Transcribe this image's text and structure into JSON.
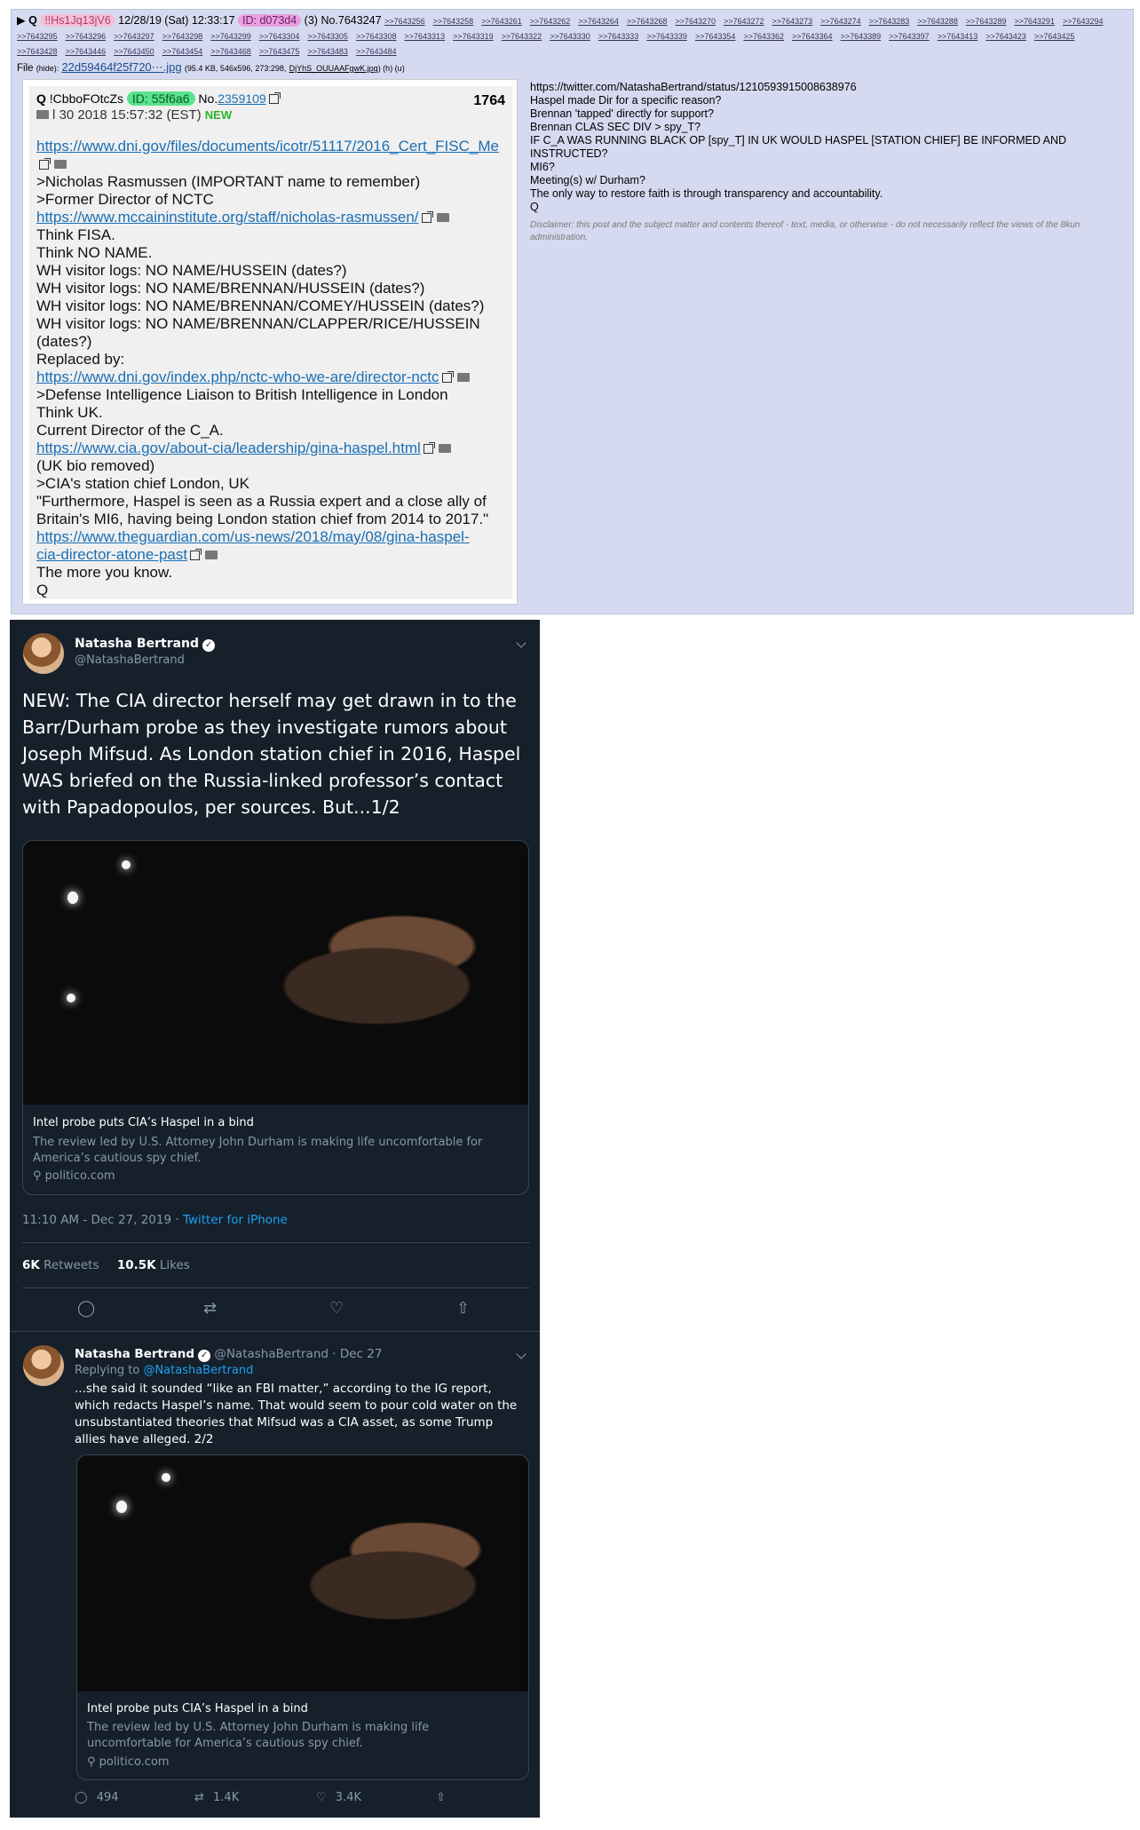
{
  "post": {
    "marker": "▶",
    "q": "Q",
    "tripcode": "!!Hs1Jq13jV6",
    "datetime": "12/28/19 (Sat) 12:33:17",
    "id_label": "ID: d073d4",
    "count": "(3)",
    "number": "No.7643247",
    "reply_links": [
      ">>7643256",
      ">>7643258",
      ">>7643261",
      ">>7643262",
      ">>7643264",
      ">>7643268",
      ">>7643270",
      ">>7643272",
      ">>7643273",
      ">>7643274",
      ">>7643283",
      ">>7643288",
      ">>7643289",
      ">>7643291",
      ">>7643294",
      ">>7643295",
      ">>7643296",
      ">>7643297",
      ">>7643298",
      ">>7643299",
      ">>7643304",
      ">>7643305",
      ">>7643308",
      ">>7643313",
      ">>7643319",
      ">>7643322",
      ">>7643330",
      ">>7643333",
      ">>7643339",
      ">>7643354",
      ">>7643362",
      ">>7643364",
      ">>7643389",
      ">>7643397",
      ">>7643413",
      ">>7643423",
      ">>7643425",
      ">>7643428",
      ">>7643446",
      ">>7643450",
      ">>7643454",
      ">>7643468",
      ">>7643475",
      ">>7643483",
      ">>7643484"
    ],
    "file_label": "File",
    "file_hide": "(hide):",
    "file_name": "22d59464f25f720⋯.jpg",
    "file_meta": "(95.4 KB, 546x596, 273:298,",
    "file_orig": "DjYhS_OUUAAFgwK.jpg",
    "file_tail": ") (h) (u)",
    "right_lines": [
      "https://twitter.com/NatashaBertrand/status/1210593915008638976",
      "Haspel made Dir for a specific reason?",
      "Brennan 'tapped' directly for support?",
      "Brennan CLAS SEC DIV > spy_T?",
      "IF C_A WAS RUNNING BLACK OP [spy_T] IN UK WOULD HASPEL [STATION CHIEF] BE INFORMED AND INSTRUCTED?",
      "MI6?",
      "Meeting(s) w/ Durham?",
      "The only way to restore faith is through transparency and accountability.",
      "Q"
    ],
    "disclaimer": "Disclaimer: this post and the subject matter and contents thereof - text, media, or otherwise - do not necessarily reflect the views of the 8kun administration."
  },
  "old_post": {
    "q": "Q",
    "trip": "!CbboFOtcZs",
    "id_label": "ID: 55f6a6",
    "number_prefix": "No.",
    "number": "2359109",
    "count": "1764",
    "date": "l 30 2018 15:57:32 (EST)",
    "new_tag": "NEW",
    "lines": [
      {
        "t": "https://www.dni.gov/files/documents/icotr/51117/2016_Cert_FISC_Me",
        "link": true
      },
      {
        "t": "",
        "icons": true
      },
      {
        "t": ">Nicholas Rasmussen (IMPORTANT name to remember)"
      },
      {
        "t": ">Former Director of NCTC"
      },
      {
        "t": "https://www.mccaininstitute.org/staff/nicholas-rasmussen/",
        "link": true,
        "icons": true
      },
      {
        "t": "Think FISA."
      },
      {
        "t": "Think NO NAME."
      },
      {
        "t": "WH visitor logs: NO NAME/HUSSEIN (dates?)"
      },
      {
        "t": "WH visitor logs: NO NAME/BRENNAN/HUSSEIN (dates?)"
      },
      {
        "t": "WH visitor logs: NO NAME/BRENNAN/COMEY/HUSSEIN (dates?)"
      },
      {
        "t": "WH visitor logs: NO NAME/BRENNAN/CLAPPER/RICE/HUSSEIN"
      },
      {
        "t": "(dates?)"
      },
      {
        "t": "Replaced by:"
      },
      {
        "t": "https://www.dni.gov/index.php/nctc-who-we-are/director-nctc",
        "link": true,
        "icons": true
      },
      {
        "t": ">Defense Intelligence Liaison to British Intelligence in London"
      },
      {
        "t": "Think UK."
      },
      {
        "t": "Current Director of the C_A."
      },
      {
        "t": "https://www.cia.gov/about-cia/leadership/gina-haspel.html",
        "link": true,
        "icons": true
      },
      {
        "t": "(UK bio removed)"
      },
      {
        "t": ">CIA's station chief London, UK"
      },
      {
        "t": "\"Furthermore, Haspel is seen as a Russia expert and a close ally of"
      },
      {
        "t": "Britain's MI6, having being London station chief from 2014 to 2017.\""
      },
      {
        "t": "https://www.theguardian.com/us-news/2018/may/08/gina-haspel-",
        "link": true
      },
      {
        "t": "cia-director-atone-past",
        "link": true,
        "icons": true
      },
      {
        "t": "The more you know."
      },
      {
        "t": "Q"
      }
    ]
  },
  "tweet1": {
    "name": "Natasha Bertrand",
    "handle": "@NatashaBertrand",
    "text": "NEW: The CIA director herself may get drawn in to the Barr/Durham probe as they investigate rumors about Joseph Mifsud. As London station chief in 2016, Haspel WAS briefed on the Russia-linked professor’s contact with Papadopoulos, per sources. But...1/2",
    "card_title": "Intel probe puts CIA’s Haspel in a bind",
    "card_desc": "The review led by U.S. Attorney John Durham is making life uncomfortable for America’s cautious spy chief.",
    "card_src": "politico.com",
    "time": "11:10 AM - Dec 27, 2019 · ",
    "app": "Twitter for iPhone",
    "retweets": "6K",
    "retweets_label": " Retweets",
    "likes": "10.5K",
    "likes_label": " Likes"
  },
  "tweet2": {
    "name": "Natasha Bertrand",
    "handle": "@NatashaBertrand · Dec 27",
    "replying": "Replying to ",
    "replying_at": "@NatashaBertrand",
    "text": "...she said it sounded “like an FBI matter,” according to the IG report, which redacts Haspel’s name. That would seem to pour cold water on the unsubstantiated theories that Mifsud was a CIA asset, as some Trump allies have alleged. 2/2",
    "card_title": "Intel probe puts CIA’s Haspel in a bind",
    "card_desc": "The review led by U.S. Attorney John Durham is making life uncomfortable for America’s cautious spy chief.",
    "card_src": "politico.com",
    "replies": "494",
    "retweets": "1.4K",
    "likes": "3.4K"
  },
  "colors": {
    "board_bg": "#d6daf0",
    "tweet_bg": "#15202b",
    "tweet_link": "#1da1f2",
    "muted": "#8899a6"
  }
}
